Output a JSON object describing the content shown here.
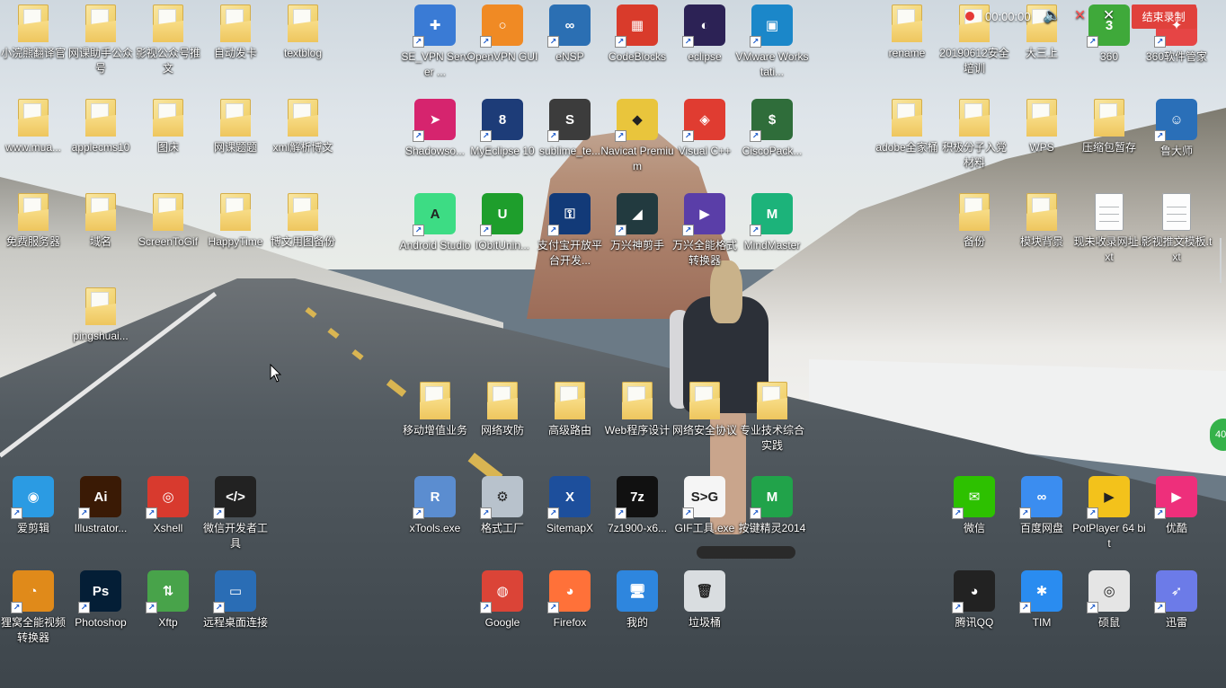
{
  "recorder": {
    "time": "00:00:00",
    "end_label": "结束录制"
  },
  "side_badge": "40",
  "icons": [
    {
      "name": "folder-xiaowanxiong",
      "label": "小浣熊翻译官",
      "kind": "folder"
    },
    {
      "name": "folder-wangke-zhushou",
      "label": "网课助手公众号",
      "kind": "folder"
    },
    {
      "name": "folder-yingshi-gongzhonghao",
      "label": "影视公众号推文",
      "kind": "folder"
    },
    {
      "name": "folder-zidong-faka",
      "label": "自动发卡",
      "kind": "folder"
    },
    {
      "name": "folder-textblog",
      "label": "textblog",
      "kind": "folder"
    },
    {
      "name": "se-vpn",
      "label": "SE_VPN Server ...",
      "kind": "app",
      "color": "#3a7bd5",
      "glyph": "✚",
      "shortcut": true
    },
    {
      "name": "openvpn",
      "label": "OpenVPN GUI",
      "kind": "app",
      "color": "#f08a24",
      "glyph": "○",
      "shortcut": true
    },
    {
      "name": "ensp",
      "label": "eNSP",
      "kind": "app",
      "color": "#2b6fb3",
      "glyph": "∞",
      "shortcut": true
    },
    {
      "name": "codeblocks",
      "label": "CodeBlocks",
      "kind": "app",
      "color": "#d93b2b",
      "glyph": "▦",
      "shortcut": true
    },
    {
      "name": "eclipse",
      "label": "eclipse",
      "kind": "app",
      "color": "#2c2255",
      "glyph": "◐",
      "shortcut": true
    },
    {
      "name": "vmware",
      "label": "VMware Workstati...",
      "kind": "app",
      "color": "#1b87c9",
      "glyph": "▣",
      "shortcut": true
    },
    {
      "name": "folder-rename",
      "label": "rename",
      "kind": "folder"
    },
    {
      "name": "folder-anquan-peixun",
      "label": "20190612安全培训",
      "kind": "folder"
    },
    {
      "name": "folder-dasanshang",
      "label": "大三上",
      "kind": "folder"
    },
    {
      "name": "app-360",
      "label": "360",
      "kind": "app",
      "color": "#3fa93a",
      "glyph": "3",
      "shortcut": true
    },
    {
      "name": "app-360-manager",
      "label": "360软件管家",
      "kind": "app",
      "color": "#e64545",
      "glyph": "✦",
      "shortcut": true
    },
    {
      "name": "folder-wwwmua",
      "label": "www.mua...",
      "kind": "folder"
    },
    {
      "name": "folder-applecms10",
      "label": "applecms10",
      "kind": "folder"
    },
    {
      "name": "folder-tuchuang",
      "label": "图床",
      "kind": "folder"
    },
    {
      "name": "folder-wangke-tiku",
      "label": "网课题题",
      "kind": "folder"
    },
    {
      "name": "folder-xml-jiexi",
      "label": "xml解析博文",
      "kind": "folder"
    },
    {
      "name": "shadowsocks",
      "label": "Shadowso...",
      "kind": "app",
      "color": "#d6246e",
      "glyph": "➤",
      "shortcut": true
    },
    {
      "name": "myeclipse",
      "label": "MyEclipse 10",
      "kind": "app",
      "color": "#1d3c78",
      "glyph": "8",
      "shortcut": true
    },
    {
      "name": "sublime",
      "label": "sublime_te...",
      "kind": "app",
      "color": "#3c3c3c",
      "glyph": "S",
      "shortcut": true
    },
    {
      "name": "navicat",
      "label": "Navicat Premium",
      "kind": "app",
      "color": "#e9c53c",
      "glyph": "◆",
      "shortcut": true
    },
    {
      "name": "visual-cpp",
      "label": "Visual C++",
      "kind": "app",
      "color": "#e03c31",
      "glyph": "◈",
      "shortcut": true
    },
    {
      "name": "ciscopacket",
      "label": "CiscoPack...",
      "kind": "app",
      "color": "#2f6d3a",
      "glyph": "$",
      "shortcut": true
    },
    {
      "name": "folder-adobe",
      "label": "adobe全家桶",
      "kind": "folder"
    },
    {
      "name": "folder-jiji-fenzi",
      "label": "积极分子入党材料",
      "kind": "folder"
    },
    {
      "name": "folder-wps",
      "label": "WPS",
      "kind": "folder"
    },
    {
      "name": "folder-yasuobao",
      "label": "压缩包暂存",
      "kind": "folder"
    },
    {
      "name": "ludashi",
      "label": "鲁大师",
      "kind": "app",
      "color": "#2a6fb8",
      "glyph": "☺",
      "shortcut": true
    },
    {
      "name": "folder-mianfei-fuwuqi",
      "label": "免费服务器",
      "kind": "folder"
    },
    {
      "name": "folder-yuming",
      "label": "域名",
      "kind": "folder"
    },
    {
      "name": "folder-screentogif",
      "label": "ScreenToGif",
      "kind": "folder"
    },
    {
      "name": "folder-happytime",
      "label": "HappyTime",
      "kind": "folder"
    },
    {
      "name": "folder-bowen-yongtu",
      "label": "博文用图备份",
      "kind": "folder"
    },
    {
      "name": "android-studio",
      "label": "Android Studio",
      "kind": "app",
      "color": "#3ddc84",
      "glyph": "A",
      "shortcut": true
    },
    {
      "name": "iobit",
      "label": "IObitUnin...",
      "kind": "app",
      "color": "#1e9e2c",
      "glyph": "U",
      "shortcut": true
    },
    {
      "name": "alipay-open",
      "label": "支付宝开放平台开发...",
      "kind": "app",
      "color": "#123a78",
      "glyph": "⚿",
      "shortcut": true
    },
    {
      "name": "filmora",
      "label": "万兴神剪手",
      "kind": "app",
      "color": "#223a3f",
      "glyph": "◢",
      "shortcut": true
    },
    {
      "name": "wondershare-converter",
      "label": "万兴全能格式转换器",
      "kind": "app",
      "color": "#5a3ea8",
      "glyph": "▶",
      "shortcut": true
    },
    {
      "name": "mindmaster",
      "label": "MindMaster",
      "kind": "app",
      "color": "#1cb37a",
      "glyph": "M",
      "shortcut": true
    },
    {
      "name": "folder-beifen",
      "label": "备份",
      "kind": "folder"
    },
    {
      "name": "folder-mokuai-beijing",
      "label": "模块背景",
      "kind": "folder"
    },
    {
      "name": "file-xianweishoulu",
      "label": "现未收录网址.txt",
      "kind": "file"
    },
    {
      "name": "file-yingshi-tuiwen",
      "label": "影视推文模板.txt",
      "kind": "file"
    },
    {
      "name": "folder-pingshuai",
      "label": "pingshuai...",
      "kind": "folder"
    },
    {
      "name": "folder-yidong-zengzhi",
      "label": "移动增值业务",
      "kind": "folder"
    },
    {
      "name": "folder-wangluo-gongfang",
      "label": "网络攻防",
      "kind": "folder"
    },
    {
      "name": "folder-gaoji-luyou",
      "label": "高级路由",
      "kind": "folder"
    },
    {
      "name": "folder-web-chengxu",
      "label": "Web程序设计",
      "kind": "folder"
    },
    {
      "name": "folder-wangluo-anquan",
      "label": "网络安全协议",
      "kind": "folder"
    },
    {
      "name": "folder-zhuanye-jishu",
      "label": "专业技术综合实践",
      "kind": "folder"
    },
    {
      "name": "aijianji",
      "label": "爱剪辑",
      "kind": "app",
      "color": "#2b9be3",
      "glyph": "◉",
      "shortcut": true
    },
    {
      "name": "illustrator",
      "label": "Illustrator...",
      "kind": "app",
      "color": "#3a1a05",
      "glyph": "Ai",
      "shortcut": true
    },
    {
      "name": "xshell",
      "label": "Xshell",
      "kind": "app",
      "color": "#d83a2e",
      "glyph": "◎",
      "shortcut": true
    },
    {
      "name": "wechat-devtools",
      "label": "微信开发者工具",
      "kind": "app",
      "color": "#222",
      "glyph": "</>",
      "shortcut": true
    },
    {
      "name": "xtools",
      "label": "xTools.exe",
      "kind": "app",
      "color": "#5b8dd0",
      "glyph": "R",
      "shortcut": true
    },
    {
      "name": "geshi-gongchang",
      "label": "格式工厂",
      "kind": "app",
      "color": "#b8c2cc",
      "glyph": "⚙",
      "shortcut": true
    },
    {
      "name": "sitemapx",
      "label": "SitemapX",
      "kind": "app",
      "color": "#1d4f9c",
      "glyph": "X",
      "shortcut": true
    },
    {
      "name": "7zip",
      "label": "7z1900-x6...",
      "kind": "app",
      "color": "#111",
      "glyph": "7z",
      "shortcut": true
    },
    {
      "name": "gif-tool",
      "label": "GIF工具.exe",
      "kind": "app",
      "color": "#f5f5f5",
      "glyph": "S>G",
      "shortcut": true
    },
    {
      "name": "anjian-jingling",
      "label": "按键精灵2014",
      "kind": "app",
      "color": "#21a34a",
      "glyph": "M",
      "shortcut": true
    },
    {
      "name": "wechat",
      "label": "微信",
      "kind": "app",
      "color": "#2dc100",
      "glyph": "✉",
      "shortcut": true
    },
    {
      "name": "baidu-netdisk",
      "label": "百度网盘",
      "kind": "app",
      "color": "#3b8df0",
      "glyph": "∞",
      "shortcut": true
    },
    {
      "name": "potplayer",
      "label": "PotPlayer 64 bit",
      "kind": "app",
      "color": "#f3c21b",
      "glyph": "▶",
      "shortcut": true
    },
    {
      "name": "youku",
      "label": "优酷",
      "kind": "app",
      "color": "#ee2f7b",
      "glyph": "▶",
      "shortcut": true
    },
    {
      "name": "lieshou-video",
      "label": "狸窝全能视频转换器",
      "kind": "app",
      "color": "#e08a1a",
      "glyph": "◔",
      "shortcut": true
    },
    {
      "name": "photoshop",
      "label": "Photoshop",
      "kind": "app",
      "color": "#041e36",
      "glyph": "Ps",
      "shortcut": true
    },
    {
      "name": "xftp",
      "label": "Xftp",
      "kind": "app",
      "color": "#48a34a",
      "glyph": "⇅",
      "shortcut": true
    },
    {
      "name": "remote-desktop",
      "label": "远程桌面连接",
      "kind": "app",
      "color": "#2a6db5",
      "glyph": "▭",
      "shortcut": true
    },
    {
      "name": "google-chrome",
      "label": "Google",
      "kind": "app",
      "color": "#db4437",
      "glyph": "◍",
      "shortcut": true
    },
    {
      "name": "firefox",
      "label": "Firefox",
      "kind": "app",
      "color": "#ff7139",
      "glyph": "◕",
      "shortcut": true
    },
    {
      "name": "my-computer",
      "label": "我的",
      "kind": "app",
      "color": "#2e86de",
      "glyph": "🖥",
      "shortcut": false
    },
    {
      "name": "recycle-bin",
      "label": "垃圾桶",
      "kind": "app",
      "color": "#d9dde0",
      "glyph": "🗑",
      "shortcut": false
    },
    {
      "name": "tencent-qq",
      "label": "腾讯QQ",
      "kind": "app",
      "color": "#222",
      "glyph": "◕",
      "shortcut": true
    },
    {
      "name": "tim",
      "label": "TIM",
      "kind": "app",
      "color": "#2a8cf0",
      "glyph": "✱",
      "shortcut": true
    },
    {
      "name": "shuoshu",
      "label": "硕鼠",
      "kind": "app",
      "color": "#e5e5e5",
      "glyph": "◎",
      "shortcut": true
    },
    {
      "name": "xunlei",
      "label": "迅雷",
      "kind": "app",
      "color": "#6c7be8",
      "glyph": "➶",
      "shortcut": true
    }
  ]
}
